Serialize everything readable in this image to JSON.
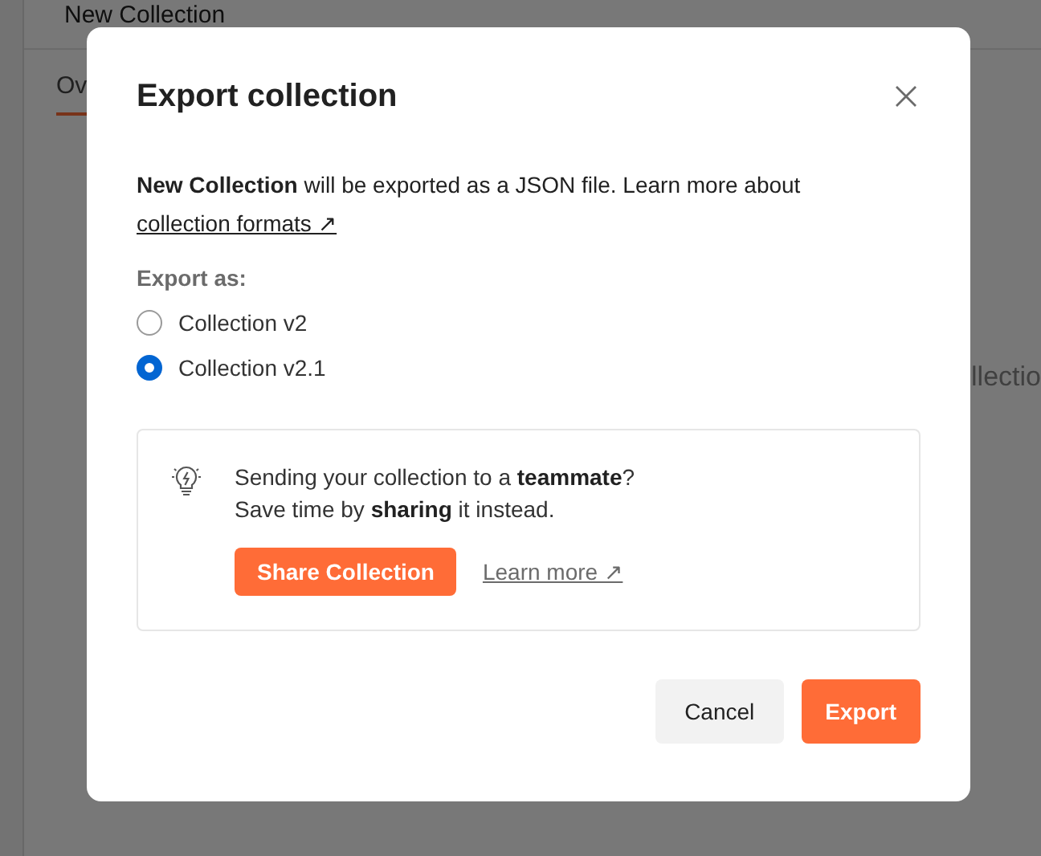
{
  "background": {
    "title": "New Collection",
    "tab": "Ov",
    "fragment": "llectio"
  },
  "dialog": {
    "title": "Export collection",
    "description": "**New Collection** will be exported as a JSON file. Learn more about",
    "link": "collection formats ↗",
    "export_label": "Export as:",
    "options": [
      {
        "label": "Collection v2",
        "selected": false
      },
      {
        "label": "Collection v2.1",
        "selected": true
      }
    ],
    "tip": {
      "lines": [
        "Sending your collection to a **teammate**?",
        "Save time by **sharing** it instead."
      ],
      "button": "Share Collection",
      "link": "Learn more ↗"
    },
    "buttons": [
      {
        "label": "Cancel",
        "kind": "secondary"
      },
      {
        "label": "Export",
        "kind": "primary"
      }
    ]
  }
}
